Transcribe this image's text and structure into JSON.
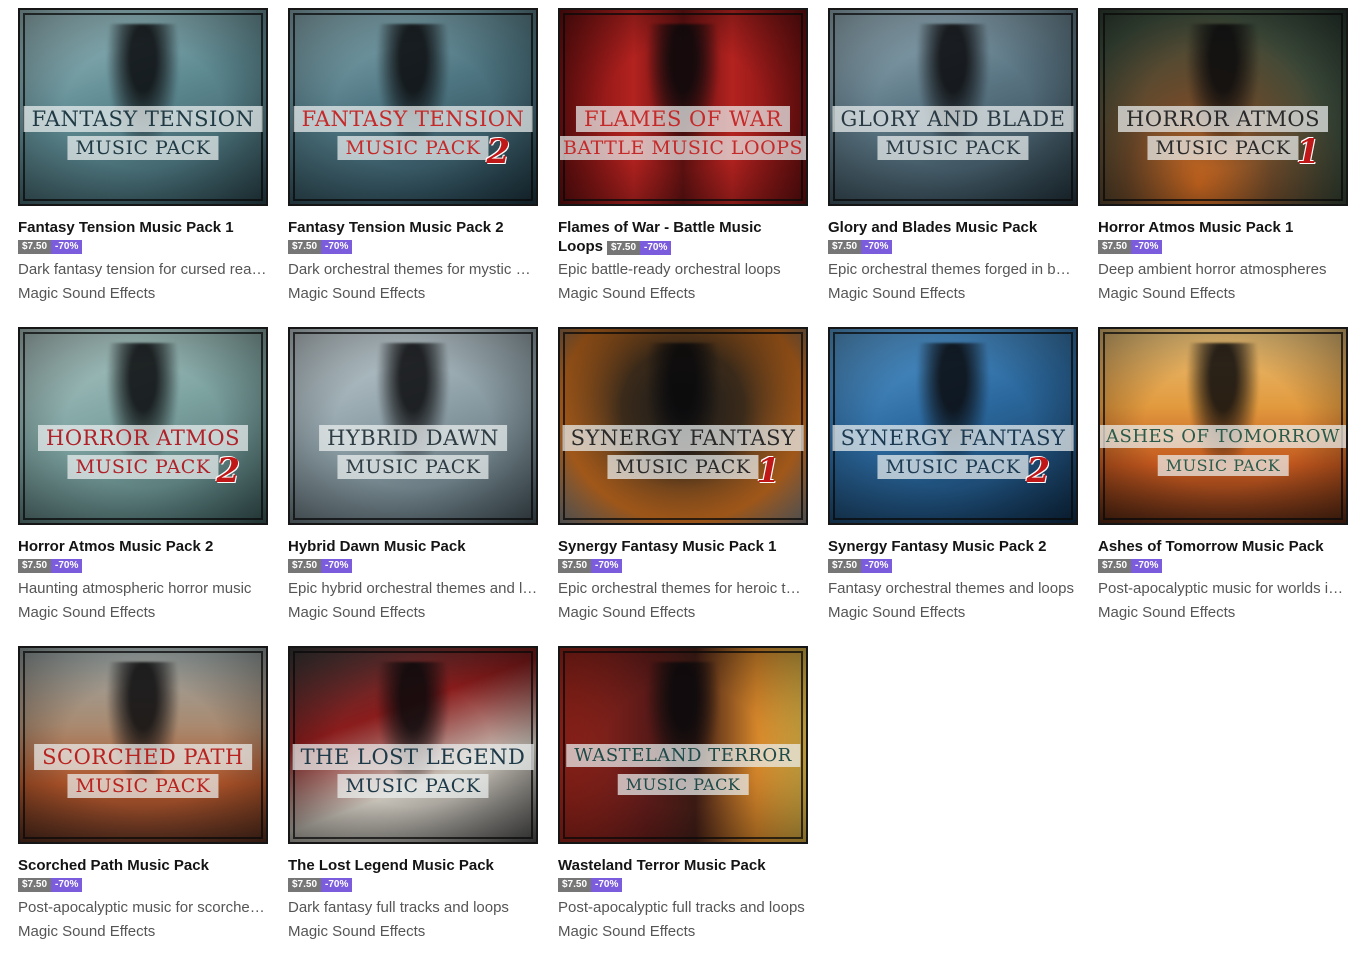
{
  "products": [
    {
      "title": "Fantasy Tension Music Pack 1",
      "price": "$7.50",
      "discount": "-70%",
      "description": "Dark fantasy tension for cursed realms",
      "author": "Magic Sound Effects",
      "cover": {
        "line1": "FANTASY TENSION",
        "line2": "MUSIC PACK",
        "number": "",
        "bg": "linear-gradient(160deg,#9fc0c4 0%,#5e8a92 45%,#2d4a52 100%)",
        "text_color": "#1f3a44"
      }
    },
    {
      "title": "Fantasy Tension Music Pack 2",
      "price": "$7.50",
      "discount": "-70%",
      "description": "Dark orchestral themes for mystic worlds",
      "author": "Magic Sound Effects",
      "cover": {
        "line1": "FANTASY TENSION",
        "line2": "MUSIC PACK",
        "number": "2",
        "bg": "linear-gradient(160deg,#8fb2ba 0%,#4e7682 45%,#1f3844 100%)",
        "text_color": "#c42a2a"
      }
    },
    {
      "title": "Flames of War - Battle Music Loops",
      "price": "$7.50",
      "discount": "-70%",
      "description": "Epic battle-ready orchestral loops",
      "author": "Magic Sound Effects",
      "cover": {
        "line1": "FLAMES OF WAR",
        "line2": "BATTLE MUSIC LOOPS",
        "number": "",
        "bg": "linear-gradient(90deg,#6e0f10 0%,#b3221f 30%,#5a1010 50%,#b3221f 70%,#6e0f10 100%)",
        "text_color": "#c42a2a"
      }
    },
    {
      "title": "Glory and Blades Music Pack",
      "price": "$7.50",
      "discount": "-70%",
      "description": "Epic orchestral themes forged in battle",
      "author": "Magic Sound Effects",
      "cover": {
        "line1": "GLORY AND BLADE",
        "line2": "MUSIC PACK",
        "number": "",
        "bg": "linear-gradient(160deg,#9eb7c2 0%,#5b7684 45%,#263842 100%)",
        "text_color": "#2a3a44"
      }
    },
    {
      "title": "Horror Atmos Music Pack 1",
      "price": "$7.50",
      "discount": "-70%",
      "description": "Deep ambient horror atmospheres",
      "author": "Magic Sound Effects",
      "cover": {
        "line1": "HORROR ATMOS",
        "line2": "MUSIC PACK",
        "number": "1",
        "bg": "radial-gradient(ellipse at 40% 90%,#c9661f 0%,#6e4a2a 35%,#3b4a3a 70%,#2a3a32 100%)",
        "text_color": "#2a2a2a"
      }
    },
    {
      "title": "Horror Atmos Music Pack 2",
      "price": "$7.50",
      "discount": "-70%",
      "description": "Haunting atmospheric horror music",
      "author": "Magic Sound Effects",
      "cover": {
        "line1": "HORROR ATMOS",
        "line2": "MUSIC PACK",
        "number": "2",
        "bg": "linear-gradient(160deg,#b5ccc9 0%,#7ea4a2 45%,#3e5e5e 100%)",
        "text_color": "#b0222a"
      }
    },
    {
      "title": "Hybrid Dawn Music Pack",
      "price": "$7.50",
      "discount": "-70%",
      "description": "Epic hybrid orchestral themes and loops",
      "author": "Magic Sound Effects",
      "cover": {
        "line1": "HYBRID DAWN",
        "line2": "MUSIC PACK",
        "number": "",
        "bg": "linear-gradient(160deg,#c9d4d8 0%,#8fa1a8 45%,#4a5a62 100%)",
        "text_color": "#2e3c44"
      }
    },
    {
      "title": "Synergy Fantasy Music Pack 1",
      "price": "$7.50",
      "discount": "-70%",
      "description": "Epic orchestral themes for heroic tales",
      "author": "Magic Sound Effects",
      "cover": {
        "line1": "SYNERGY FANTASY",
        "line2": "MUSIC PACK",
        "number": "1",
        "bg": "radial-gradient(ellipse at 50% 40%,#1a1a1a 0%,#3a2a1a 35%,#c36a1e 70%,#8a8a8a 100%)",
        "text_color": "#2a2a2a"
      }
    },
    {
      "title": "Synergy Fantasy Music Pack 2",
      "price": "$7.50",
      "discount": "-70%",
      "description": "Fantasy orchestral themes and loops",
      "author": "Magic Sound Effects",
      "cover": {
        "line1": "SYNERGY FANTASY",
        "line2": "MUSIC PACK",
        "number": "2",
        "bg": "linear-gradient(160deg,#5aa0d8 0%,#2c6aa0 45%,#10304e 100%)",
        "text_color": "#1c3a52"
      }
    },
    {
      "title": "Ashes of Tomorrow Music Pack",
      "price": "$7.50",
      "discount": "-70%",
      "description": "Post-apocalyptic music for worlds in ruin",
      "author": "Magic Sound Effects",
      "cover": {
        "line1": "ASHES OF TOMORROW",
        "line2": "MUSIC PACK",
        "number": "",
        "bg": "linear-gradient(180deg,#e9c27a 0%,#e29a3e 40%,#c2571e 70%,#5a2a14 100%)",
        "text_color": "#2a5a4a"
      }
    },
    {
      "title": "Scorched Path Music Pack",
      "price": "$7.50",
      "discount": "-70%",
      "description": "Post-apocalyptic music for scorched lands",
      "author": "Magic Sound Effects",
      "cover": {
        "line1": "SCORCHED PATH",
        "line2": "MUSIC PACK",
        "number": "",
        "bg": "linear-gradient(180deg,#9aa7a8 0%,#a98a70 40%,#b0552a 70%,#5a3020 100%)",
        "text_color": "#b8221f"
      }
    },
    {
      "title": "The Lost Legend Music Pack",
      "price": "$7.50",
      "discount": "-70%",
      "description": "Dark fantasy full tracks and loops",
      "author": "Magic Sound Effects",
      "cover": {
        "line1": "THE LOST LEGEND",
        "line2": "MUSIC PACK",
        "number": "",
        "bg": "linear-gradient(160deg,#3a3a3a 0%,#8a1c1c 35%,#c7c2b8 65%,#555 100%)",
        "text_color": "#1e3a48"
      }
    },
    {
      "title": "Wasteland Terror Music Pack",
      "price": "$7.50",
      "discount": "-70%",
      "description": "Post-apocalyptic full tracks and loops",
      "author": "Magic Sound Effects",
      "cover": {
        "line1": "WASTELAND TERROR",
        "line2": "MUSIC PACK",
        "number": "",
        "bg": "linear-gradient(90deg,#a3261c 0%,#5a1a18 35%,#3a1a14 55%,#d4852a 80%,#eabf4a 100%)",
        "text_color": "#1e4a48"
      }
    }
  ]
}
